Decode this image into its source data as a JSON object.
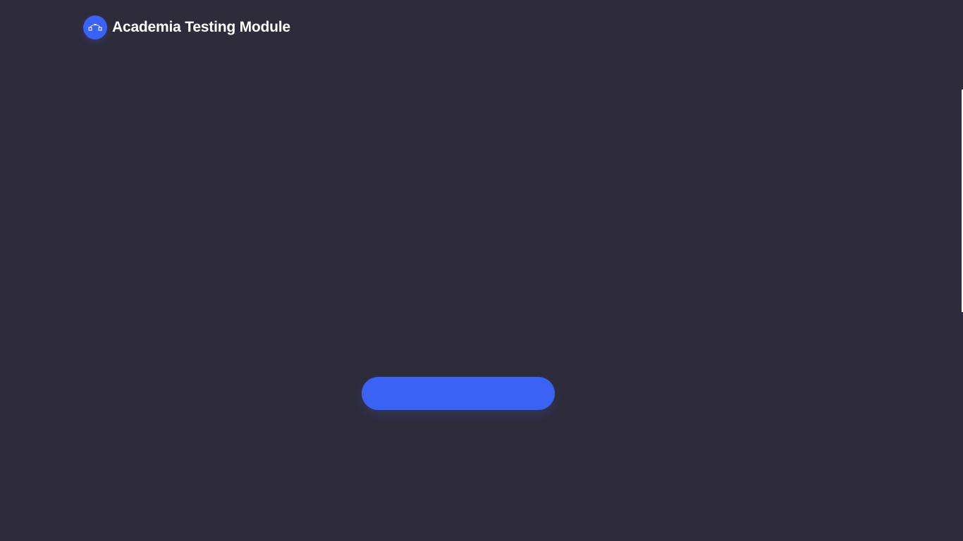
{
  "header": {
    "title": "Academia Testing Module",
    "logo_icon": "node-graph-icon"
  },
  "main": {
    "primary_button_label": ""
  },
  "colors": {
    "background": "#2e2c3a",
    "accent": "#3a63f5",
    "text": "#ffffff"
  }
}
